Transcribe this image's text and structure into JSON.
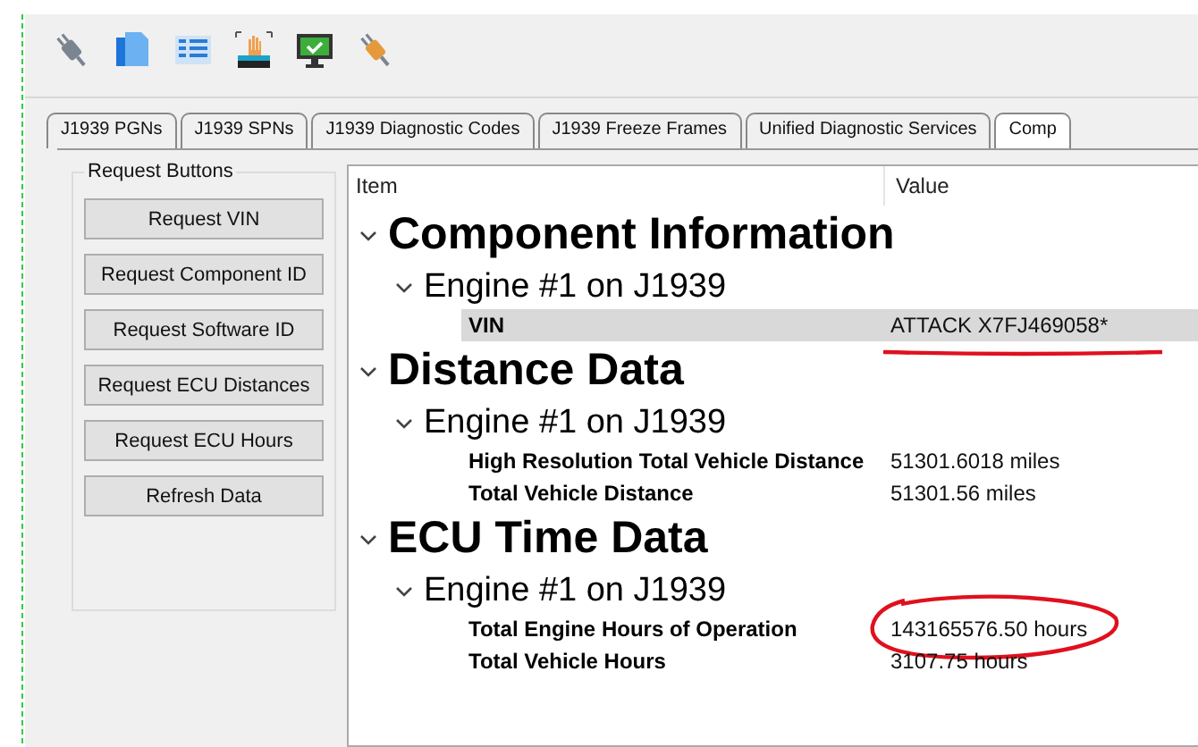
{
  "tabs": [
    {
      "label": "J1939 PGNs",
      "selected": false
    },
    {
      "label": "J1939 SPNs",
      "selected": false
    },
    {
      "label": "J1939 Diagnostic Codes",
      "selected": false
    },
    {
      "label": "J1939 Freeze Frames",
      "selected": false
    },
    {
      "label": "Unified Diagnostic Services",
      "selected": false
    },
    {
      "label": "Comp",
      "selected": true
    }
  ],
  "request_buttons": {
    "title": "Request Buttons",
    "buttons": [
      "Request VIN",
      "Request Component ID",
      "Request Software ID",
      "Request ECU Distances",
      "Request ECU Hours",
      "Refresh Data"
    ]
  },
  "tree": {
    "columns": [
      "Item",
      "Value"
    ],
    "sections": [
      {
        "label": "Component Information",
        "expanded": true,
        "children": [
          {
            "label": "Engine #1 on J1939",
            "expanded": true,
            "children": [
              {
                "label": "VIN",
                "value": "ATTACK X7FJ469058*",
                "selected": true,
                "underlined": true,
                "circled": false
              }
            ]
          }
        ]
      },
      {
        "label": "Distance Data",
        "expanded": true,
        "children": [
          {
            "label": "Engine #1 on J1939",
            "expanded": true,
            "children": [
              {
                "label": "High Resolution Total Vehicle Distance",
                "value": "51301.6018 miles",
                "selected": false,
                "underlined": false,
                "circled": false
              },
              {
                "label": "Total Vehicle Distance",
                "value": "51301.56 miles",
                "selected": false,
                "underlined": false,
                "circled": false
              }
            ]
          }
        ]
      },
      {
        "label": "ECU Time Data",
        "expanded": true,
        "children": [
          {
            "label": "Engine #1 on J1939",
            "expanded": true,
            "children": [
              {
                "label": "Total Engine Hours of Operation",
                "value": "143165576.50 hours",
                "selected": false,
                "underlined": false,
                "circled": true
              },
              {
                "label": "Total Vehicle Hours",
                "value": "3107.75 hours",
                "selected": false,
                "underlined": false,
                "circled": false
              }
            ]
          }
        ]
      }
    ]
  }
}
